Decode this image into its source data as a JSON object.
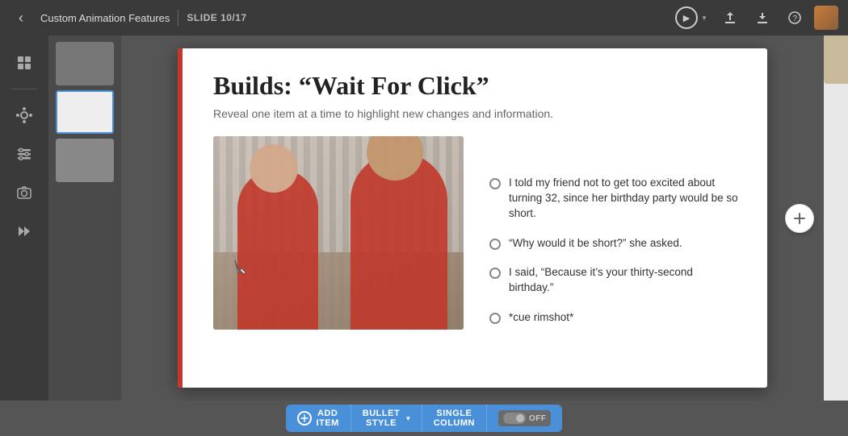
{
  "topbar": {
    "back_icon": "‹",
    "title": "Custom Animation Features",
    "slide_counter": "SLIDE 10/17",
    "play_icon": "▶",
    "dropdown_arrow": "▾",
    "share_icon": "⬆",
    "download_icon": "⬇",
    "help_icon": "?",
    "avatar_alt": "user avatar"
  },
  "sidebar": {
    "items": [
      {
        "icon": "⊞",
        "name": "grid-icon",
        "label": "Grid"
      },
      {
        "icon": "✦",
        "name": "apps-icon",
        "label": "Apps"
      },
      {
        "icon": "⚙",
        "name": "settings-icon",
        "label": "Settings"
      },
      {
        "icon": "◎",
        "name": "camera-icon",
        "label": "Camera"
      },
      {
        "icon": "⏭",
        "name": "skip-icon",
        "label": "Skip"
      }
    ]
  },
  "slide": {
    "title": "Builds: “Wait For Click”",
    "subtitle": "Reveal one item at a time to highlight new changes and information.",
    "bullets": [
      {
        "text": "I told my friend not to get too excited about turning 32, since her birthday party would be so short."
      },
      {
        "text": "“Why would it be short?” she asked."
      },
      {
        "text": "I said, “Because it’s your thirty-second birthday.”"
      },
      {
        "text": "*cue rimshot*"
      }
    ]
  },
  "toolbar": {
    "add_icon": "+",
    "add_label": "ADD",
    "add_sublabel": "ITEM",
    "bullet_label": "BULLET",
    "bullet_sublabel": "STYLE",
    "dropdown_arrow": "▾",
    "single_column_label": "SINGLE",
    "single_column_sublabel": "COLUMN",
    "toggle_label": "OFF"
  }
}
